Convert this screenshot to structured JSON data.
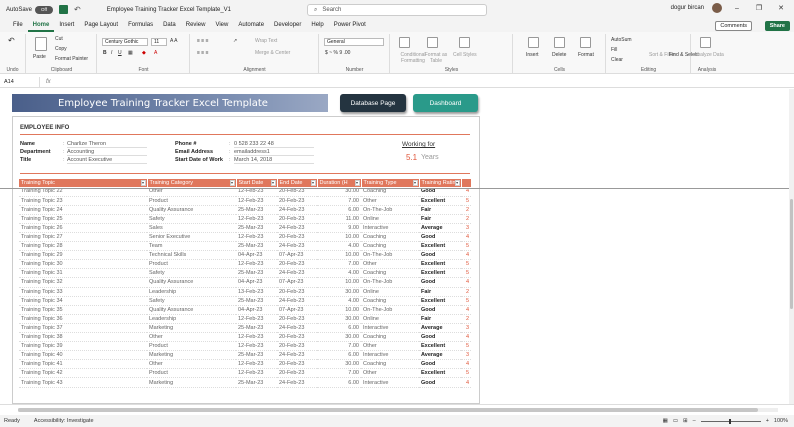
{
  "titlebar": {
    "autosave_label": "AutoSave",
    "autosave_state": "Off",
    "doc_title": "Employee Training Tracker Excel Template_V1",
    "search_placeholder": "Search",
    "user_name": "dogur bircan"
  },
  "menu": {
    "items": [
      "File",
      "Home",
      "Insert",
      "Page Layout",
      "Formulas",
      "Data",
      "Review",
      "View",
      "Automate",
      "Developer",
      "Help",
      "Power Pivot"
    ],
    "active": "Home",
    "comments": "Comments",
    "share": "Share"
  },
  "ribbon": {
    "undo": "Undo",
    "paste": "Paste",
    "cut": "Cut",
    "copy": "Copy",
    "format_painter": "Format Painter",
    "clipboard": "Clipboard",
    "font_name": "Century Gothic",
    "font_size": "11",
    "font": "Font",
    "wrap_text": "Wrap Text",
    "merge_center": "Merge & Center",
    "alignment": "Alignment",
    "number_format": "General",
    "number": "Number",
    "conditional": "Conditional Formatting",
    "format_table": "Format as Table",
    "cell_styles": "Cell Styles",
    "styles": "Styles",
    "insert": "Insert",
    "delete": "Delete",
    "format": "Format",
    "cells": "Cells",
    "autosum": "AutoSum",
    "fill": "Fill",
    "clear": "Clear",
    "sort_filter": "Sort & Filter",
    "find_select": "Find & Select",
    "editing": "Editing",
    "analyze": "Analyze Data",
    "analysis": "Analysis"
  },
  "formula_bar": {
    "cell": "A14",
    "fx": "fx",
    "value": ""
  },
  "sheet": {
    "banner": "Employee Training Tracker Excel Template",
    "btn_database": "Database Page",
    "btn_dashboard": "Dashboard",
    "emp_head": "EMPLOYEE INFO",
    "name_label": "Name",
    "name_value": "Charlize Theron",
    "dept_label": "Department",
    "dept_value": "Accounting",
    "title_label": "Title",
    "title_value": "Account Executive",
    "phone_label": "Phone #",
    "phone_value": "0 528 233 22 48",
    "email_label": "Email Address",
    "email_value": "emailaddress1",
    "start_label": "Start Date of Work",
    "start_value": "March 14, 2018",
    "working_label": "Working for",
    "working_num": "5.1",
    "working_unit": "Years",
    "headers": [
      "Training Topic",
      "Training Category",
      "Start Date",
      "End Date",
      "Duration (H",
      "Training Type",
      "Training Rating",
      ""
    ],
    "rows": [
      [
        "Training Topic 22",
        "Other",
        "12-Feb-23",
        "20-Feb-23",
        "30.00",
        "Coaching",
        "Good",
        "4"
      ],
      [
        "Training Topic 23",
        "Product",
        "12-Feb-23",
        "20-Feb-23",
        "7.00",
        "Other",
        "Excellent",
        "5"
      ],
      [
        "Training Topic 24",
        "Quality Assurance",
        "25-Mar-23",
        "24-Feb-23",
        "6.00",
        "On-The-Job",
        "Fair",
        "2"
      ],
      [
        "Training Topic 25",
        "Safety",
        "12-Feb-23",
        "20-Feb-23",
        "11.00",
        "Online",
        "Fair",
        "2"
      ],
      [
        "Training Topic 26",
        "Sales",
        "25-Mar-23",
        "24-Feb-23",
        "9.00",
        "Interactive",
        "Average",
        "3"
      ],
      [
        "Training Topic 27",
        "Senior Executive",
        "12-Feb-23",
        "20-Feb-23",
        "10.00",
        "Coaching",
        "Good",
        "4"
      ],
      [
        "Training Topic 28",
        "Team",
        "25-Mar-23",
        "24-Feb-23",
        "4.00",
        "Coaching",
        "Excellent",
        "5"
      ],
      [
        "Training Topic 29",
        "Technical Skills",
        "04-Apr-23",
        "07-Apr-23",
        "10.00",
        "On-The-Job",
        "Good",
        "4"
      ],
      [
        "Training Topic 30",
        "Product",
        "12-Feb-23",
        "20-Feb-23",
        "7.00",
        "Other",
        "Excellent",
        "5"
      ],
      [
        "Training Topic 31",
        "Safety",
        "25-Mar-23",
        "24-Feb-23",
        "4.00",
        "Coaching",
        "Excellent",
        "5"
      ],
      [
        "Training Topic 32",
        "Quality Assurance",
        "04-Apr-23",
        "07-Apr-23",
        "10.00",
        "On-The-Job",
        "Good",
        "4"
      ],
      [
        "Training Topic 33",
        "Leadership",
        "13-Feb-23",
        "20-Feb-23",
        "30.00",
        "Online",
        "Fair",
        "2"
      ],
      [
        "Training Topic 34",
        "Safety",
        "25-Mar-23",
        "24-Feb-23",
        "4.00",
        "Coaching",
        "Excellent",
        "5"
      ],
      [
        "Training Topic 35",
        "Quality Assurance",
        "04-Apr-23",
        "07-Apr-23",
        "10.00",
        "On-The-Job",
        "Good",
        "4"
      ],
      [
        "Training Topic 36",
        "Leadership",
        "12-Feb-23",
        "20-Feb-23",
        "30.00",
        "Online",
        "Fair",
        "2"
      ],
      [
        "Training Topic 37",
        "Marketing",
        "25-Mar-23",
        "24-Feb-23",
        "6.00",
        "Interactive",
        "Average",
        "3"
      ],
      [
        "Training Topic 38",
        "Other",
        "12-Feb-23",
        "20-Feb-23",
        "30.00",
        "Coaching",
        "Good",
        "4"
      ],
      [
        "Training Topic 39",
        "Product",
        "12-Feb-23",
        "20-Feb-23",
        "7.00",
        "Other",
        "Excellent",
        "5"
      ],
      [
        "Training Topic 40",
        "Marketing",
        "25-Mar-23",
        "24-Feb-23",
        "6.00",
        "Interactive",
        "Average",
        "3"
      ],
      [
        "Training Topic 41",
        "Other",
        "12-Feb-23",
        "20-Feb-23",
        "30.00",
        "Coaching",
        "Good",
        "4"
      ],
      [
        "Training Topic 42",
        "Product",
        "12-Feb-23",
        "20-Feb-23",
        "7.00",
        "Other",
        "Excellent",
        "5"
      ],
      [
        "Training Topic 43",
        "Marketing",
        "25-Mar-23",
        "24-Feb-23",
        "6.00",
        "Interactive",
        "Good",
        "4"
      ]
    ]
  },
  "status": {
    "ready": "Ready",
    "accessibility": "Accessibility: Investigate",
    "zoom": "100%"
  },
  "colors": {
    "accent": "#217346",
    "table_header": "#e0775c",
    "score": "#e0563a"
  }
}
